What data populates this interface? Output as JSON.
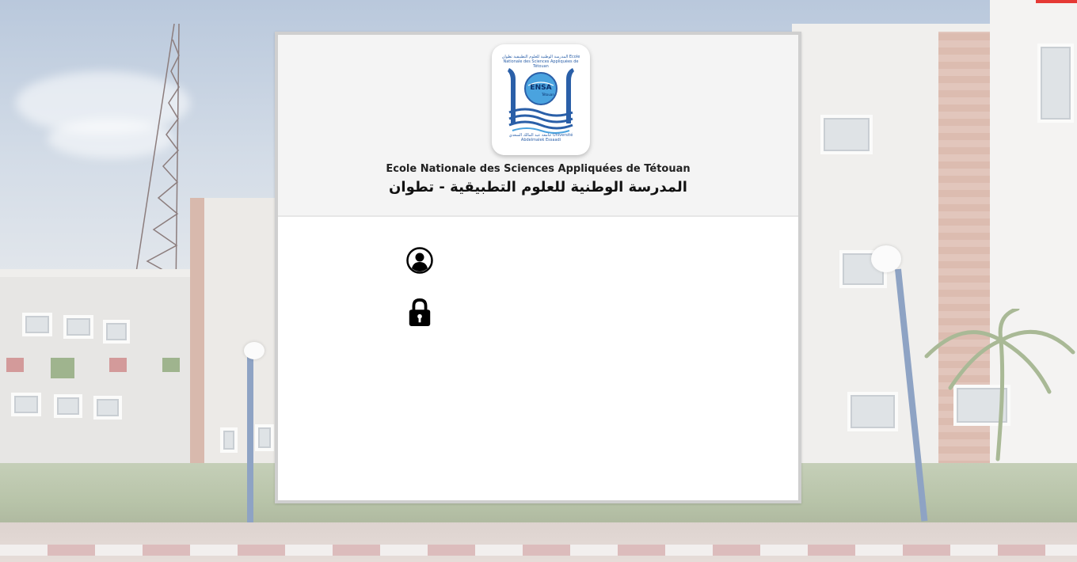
{
  "school": {
    "name_fr": "Ecole Nationale des Sciences Appliquées de Tétouan",
    "name_ar": "المدرسة الوطنية للعلوم التطبيقية - تطوان",
    "logo": {
      "top_text": "المدرسة الوطنية للعلوم التطبيقية تطوان Ecole Nationale des Sciences Appliquées de Tétouan",
      "mark_text": "ENSA",
      "mark_subtext": "Tétouan",
      "bottom_text": "جامعة عبد المالك السعدي Université Abdelmalek Essaadi"
    }
  },
  "login": {
    "username": {
      "icon": "user-circle-icon",
      "value": "",
      "placeholder": ""
    },
    "password": {
      "icon": "lock-icon",
      "value": "",
      "placeholder": ""
    }
  },
  "colors": {
    "logo_blue": "#2a5fa8",
    "logo_light_blue": "#4aa3df",
    "header_bg": "#f4f4f4",
    "card_border": "#cfcfcf"
  }
}
